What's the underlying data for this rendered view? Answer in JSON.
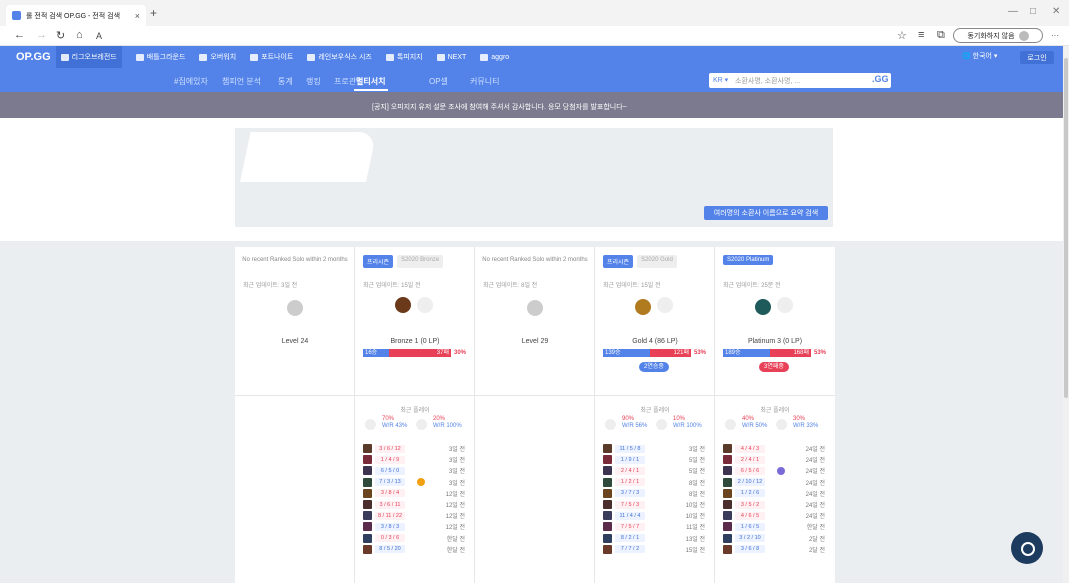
{
  "browser": {
    "tab_title": "롤 전적 검색 OP.GG - 전적 검색",
    "tab_close": "×",
    "new_tab": "+",
    "address_bar": "A",
    "profile_label": "동기화하지 않음",
    "more": "···"
  },
  "topnav": {
    "logo": "OP.GG",
    "items": [
      "리그오브레전드",
      "배틀그라운드",
      "오버워치",
      "포트나이트",
      "레인보우식스 시즈",
      "톡피지지",
      "NEXT",
      "aggro"
    ],
    "lang": "한국어 ▾",
    "login": "로그인"
  },
  "subnav": {
    "items": [
      "#집에있자",
      "챔피언 분석",
      "통계",
      "랭킹",
      "프로관전",
      "멀티서치",
      "OP셀",
      "커뮤니티"
    ],
    "active_index": 5,
    "search_region": "KR ▾",
    "search_placeholder": "소환사명, 소환사명, ...",
    "search_button": ".GG"
  },
  "notice": "[공지] 오피지지 유저 설문 조사에 참여해 주셔서 감사합니다. 응모 당첨자를 발표합니다~",
  "multisearch": {
    "button": "여러명의 소환사 이름으로 요약 검색"
  },
  "summoners": [
    {
      "no_rank": "No recent Ranked Solo within 2 months",
      "updated": "최근 업데이트: 3일 전",
      "tier": "Level 24",
      "games": []
    },
    {
      "badge_main": "프리시즌",
      "badge_season": "S2020 Bronze",
      "updated": "최근 업데이트: 15일 전",
      "tier": "Bronze 1 (0 LP)",
      "wins": "16승",
      "losses": "37패",
      "winrate": "30%",
      "win_fraction": 0.3,
      "recent_label": "최근 플레이",
      "pos1_pct": "70%",
      "pos1_wr": "W/R 43%",
      "pos2_pct": "20%",
      "pos2_wr": "W/R 100%",
      "games": [
        {
          "kda": "3 / 6 / 12",
          "when": "3일 전",
          "result": "L"
        },
        {
          "kda": "1 / 4 / 9",
          "when": "3일 전",
          "result": "L"
        },
        {
          "kda": "6 / 5 / 0",
          "when": "3일 전",
          "result": "W"
        },
        {
          "kda": "7 / 3 / 13",
          "when": "3일 전",
          "result": "W",
          "mvp": true
        },
        {
          "kda": "3 / 8 / 4",
          "when": "12일 전",
          "result": "L"
        },
        {
          "kda": "3 / 6 / 11",
          "when": "12일 전",
          "result": "L"
        },
        {
          "kda": "8 / 11 / 22",
          "when": "12일 전",
          "result": "L"
        },
        {
          "kda": "3 / 8 / 3",
          "when": "12일 전",
          "result": "W"
        },
        {
          "kda": "0 / 3 / 6",
          "when": "한달 전",
          "result": "L"
        },
        {
          "kda": "8 / 5 / 20",
          "when": "한달 전",
          "result": "W"
        }
      ]
    },
    {
      "no_rank": "No recent Ranked Solo within 2 months",
      "updated": "최근 업데이트: 8일 전",
      "tier": "Level 29",
      "games": []
    },
    {
      "badge_main": "프리시즌",
      "badge_season": "S2020 Gold",
      "updated": "최근 업데이트: 15일 전",
      "tier": "Gold 4 (86 LP)",
      "wins": "139승",
      "losses": "121패",
      "winrate": "53%",
      "win_fraction": 0.53,
      "streak": "2연승중",
      "streak_color": "#5383e8",
      "recent_label": "최근 플레이",
      "pos1_pct": "90%",
      "pos1_wr": "W/R 56%",
      "pos2_pct": "10%",
      "pos2_wr": "W/R 100%",
      "games": [
        {
          "kda": "11 / 5 / 8",
          "when": "3일 전",
          "result": "W"
        },
        {
          "kda": "1 / 9 / 1",
          "when": "5일 전",
          "result": "W"
        },
        {
          "kda": "2 / 4 / 1",
          "when": "5일 전",
          "result": "L"
        },
        {
          "kda": "1 / 2 / 1",
          "when": "8일 전",
          "result": "L"
        },
        {
          "kda": "3 / 7 / 3",
          "when": "8일 전",
          "result": "W"
        },
        {
          "kda": "7 / 5 / 3",
          "when": "10일 전",
          "result": "L"
        },
        {
          "kda": "11 / 4 / 4",
          "when": "10일 전",
          "result": "W"
        },
        {
          "kda": "7 / 5 / 7",
          "when": "11일 전",
          "result": "L"
        },
        {
          "kda": "8 / 2 / 1",
          "when": "13일 전",
          "result": "W"
        },
        {
          "kda": "7 / 7 / 2",
          "when": "15일 전",
          "result": "W"
        }
      ]
    },
    {
      "badge_main": "S2020 Platinum",
      "updated": "최근 업데이트: 25분 전",
      "tier": "Platinum 3 (0 LP)",
      "wins": "189승",
      "losses": "168패",
      "winrate": "53%",
      "win_fraction": 0.53,
      "streak": "3연패중",
      "streak_color": "#e84057",
      "recent_label": "최근 플레이",
      "pos1_pct": "40%",
      "pos1_wr": "W/R 50%",
      "pos2_pct": "30%",
      "pos2_wr": "W/R 33%",
      "games": [
        {
          "kda": "4 / 4 / 3",
          "when": "24일 전",
          "result": "L"
        },
        {
          "kda": "2 / 4 / 1",
          "when": "24일 전",
          "result": "L"
        },
        {
          "kda": "6 / 5 / 6",
          "when": "24일 전",
          "result": "L",
          "ace": true
        },
        {
          "kda": "2 / 10 / 12",
          "when": "24일 전",
          "result": "W"
        },
        {
          "kda": "1 / 2 / 6",
          "when": "24일 전",
          "result": "W"
        },
        {
          "kda": "3 / 5 / 2",
          "when": "24일 전",
          "result": "L"
        },
        {
          "kda": "4 / 6 / 5",
          "when": "24일 전",
          "result": "L"
        },
        {
          "kda": "1 / 6 / 5",
          "when": "한달 전",
          "result": "W"
        },
        {
          "kda": "3 / 2 / 10",
          "when": "2달 전",
          "result": "W"
        },
        {
          "kda": "3 / 6 / 8",
          "when": "2달 전",
          "result": "W"
        }
      ]
    }
  ],
  "colors": {
    "accent": "#5383e8",
    "loss": "#e84057",
    "notice_bg": "#7b7a8e"
  }
}
